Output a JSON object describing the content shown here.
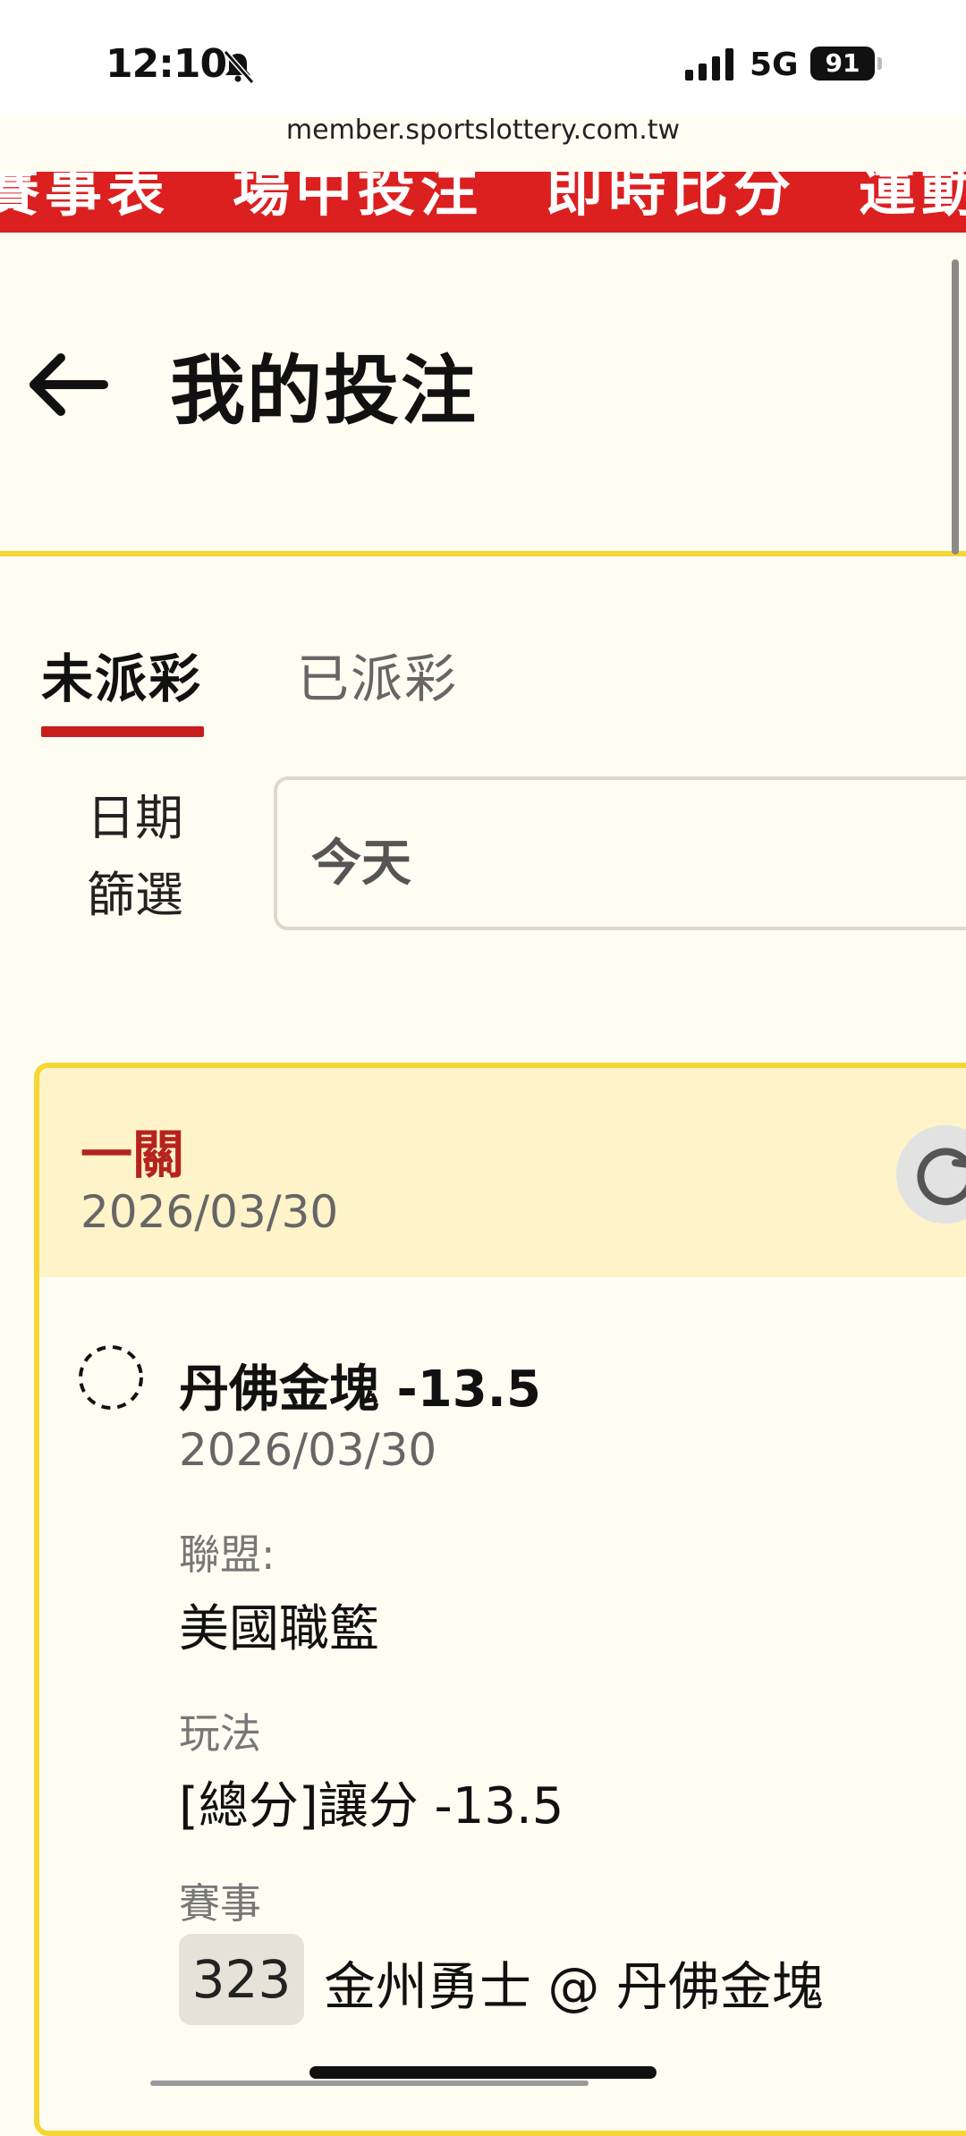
{
  "status_bar": {
    "time": "12:10",
    "network": "5G",
    "battery": "91"
  },
  "browser": {
    "url": "member.sportslottery.com.tw"
  },
  "ticker": {
    "text": "賽事表　場中投注　即時比分　運動"
  },
  "header": {
    "title": "我的投注"
  },
  "tabs": [
    {
      "label": "未派彩",
      "active": true
    },
    {
      "label": "已派彩",
      "active": false
    }
  ],
  "filter": {
    "label_line1": "日期",
    "label_line2": "篩選",
    "value": "今天"
  },
  "bet_card": {
    "type": "一關",
    "date": "2026/03/30",
    "selection": "丹佛金塊 -13.5",
    "selection_date": "2026/03/30",
    "league_label": "聯盟:",
    "league": "美國職籃",
    "market_label": "玩法",
    "market": "[總分]讓分 -13.5",
    "event_label": "賽事",
    "game_number": "323",
    "matchup": "金州勇士 @ 丹佛金塊"
  },
  "colors": {
    "accent_red": "#dc1f1f",
    "highlight_yellow": "#f6d634",
    "card_header_bg": "#fff3c9",
    "page_bg": "#fffcf2"
  }
}
